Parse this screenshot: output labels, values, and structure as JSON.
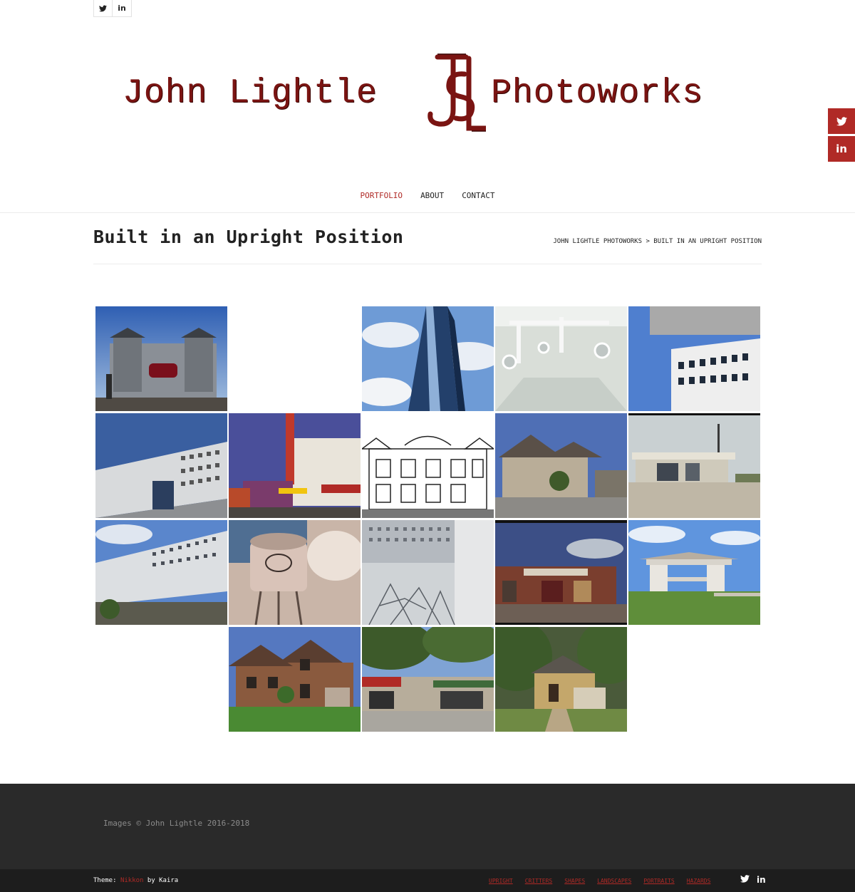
{
  "top_social": {
    "twitter_glyph": "🐦",
    "linkedin_glyph": "in"
  },
  "floating_social": {
    "twitter_glyph": "🐦",
    "linkedin_glyph": "in",
    "color": "#b02a26"
  },
  "logo": {
    "word1": "John Lightle",
    "word2": "Photoworks",
    "monogram": "JSL",
    "color": "#7a1412"
  },
  "nav": [
    {
      "label": "PORTFOLIO",
      "active": true
    },
    {
      "label": "ABOUT",
      "active": false
    },
    {
      "label": "CONTACT",
      "active": false
    }
  ],
  "page": {
    "title": "Built in an Upright Position",
    "breadcrumb_home": "JOHN LIGHTLE PHOTOWORKS",
    "breadcrumb_sep": ">",
    "breadcrumb_current": "BUILT IN AN UPRIGHT POSITION"
  },
  "gallery": [
    {
      "subject": "dr-pepper-building"
    },
    {
      "subject": "glass-skyscraper"
    },
    {
      "subject": "operating-room"
    },
    {
      "subject": "white-modern-building"
    },
    {
      "subject": "perforated-facade-building"
    },
    {
      "subject": "theater-marquee-street"
    },
    {
      "subject": "sketch-historic-building"
    },
    {
      "subject": "suburban-house"
    },
    {
      "subject": "abandoned-station"
    },
    {
      "subject": "perforated-building-plaza"
    },
    {
      "subject": "blue-ridge-water-tower"
    },
    {
      "subject": "perforated-building-trees"
    },
    {
      "subject": "feed-mill-storefront"
    },
    {
      "subject": "small-white-pavilion"
    },
    {
      "subject": "brick-house"
    },
    {
      "subject": "storefront-under-trees"
    },
    {
      "subject": "yellow-cottage"
    }
  ],
  "footer": {
    "copyright": "Images © John Lightle 2016-2018",
    "theme_prefix": "Theme:",
    "theme_link": "Nikkon",
    "theme_by": "by Kaira",
    "menu": [
      "UPRIGHT",
      "CRITTERS",
      "SHAPES",
      "LANDSCAPES",
      "PORTRAITS",
      "HAZARDS"
    ],
    "twitter_glyph": "🐦",
    "linkedin_glyph": "in"
  }
}
